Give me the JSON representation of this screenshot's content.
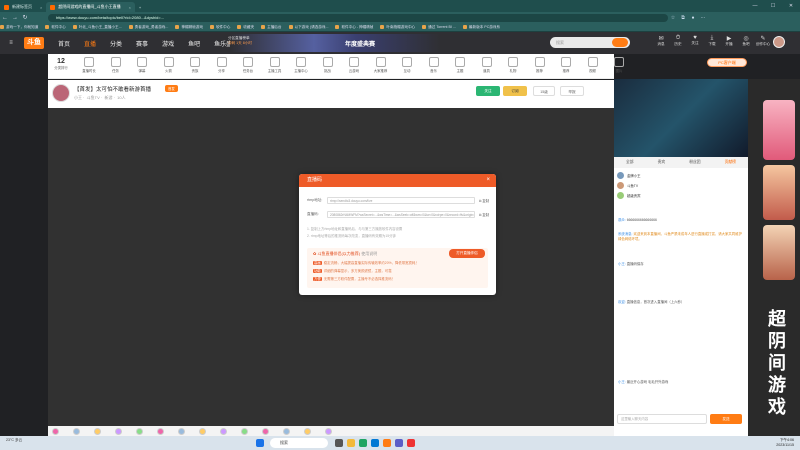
{
  "browser": {
    "tabs": [
      {
        "label": "新建标签页",
        "active": false
      },
      {
        "label": "超阴间游戏的直播间_斗鱼小王直播",
        "active": true
      }
    ],
    "new_tab": "+",
    "url": "https://www.douyu.com/beta/topic/bell?rid=2080...&dyshid=...",
    "bookmarks": [
      "游戏一下，你就知道",
      "软件中心",
      "叶北_斗鱼小王_直播小王...",
      "勇者游戏_勇者游戏...",
      "神帽精帧游戏",
      "软件中心",
      "收藏夹",
      "主播后台",
      "以下游戏 (请选游戏...",
      "软件中心 - 神帽精帧",
      "叶南拖帽游戏中心",
      "通过 Torrent BI ...",
      "最新版本 PC游戏系"
    ]
  },
  "douyu_header": {
    "logo": "斗鱼",
    "nav": [
      "首页",
      "直播",
      "分类",
      "赛事",
      "游戏",
      "鱼吧",
      "鱼乐盛典"
    ],
    "promo_lines": [
      "分区直播榜单",
      "冲刺 1天 8小时"
    ],
    "event": "年度盛典赛",
    "search_placeholder": "搜索",
    "header_icons": [
      "消息",
      "历史",
      "关注",
      "下载",
      "开播",
      "鱼吧",
      "创作中心"
    ]
  },
  "category_row": {
    "count": "12",
    "count_label": "分类排行",
    "items": [
      "直播时长",
      "任务",
      "弹幕",
      "火箭",
      "贵族",
      "分享",
      "任务台",
      "主播工具",
      "主播中心",
      "挑战",
      "云游戏",
      "大家推荐",
      "互动",
      "音乐",
      "主题",
      "道具",
      "礼物",
      "推荐",
      "推荐",
      "视频",
      "图片"
    ],
    "pc_client": "PC客户端"
  },
  "stream": {
    "title": "【首发】太可怕不敢看新游首播",
    "badge": "首发",
    "tags": [
      "小王",
      "斗鱼TV",
      "新游",
      "10人"
    ],
    "follow_btn": "关注",
    "sub_btn": "订阅",
    "level": "15级",
    "report": "举报"
  },
  "dialog": {
    "title": "直播码",
    "close": "×",
    "rtmp_label": "rtmp地址:",
    "rtmp_value": "rtmp://sendtc3.douyu.com/live",
    "code_label": "直播码:",
    "code_value": "2080862rN4MWFM?wsSecret=...&wsTime=...&wsSeek=off&wm=0&tw=0&roirpe=0&record=flv&origin=tct",
    "copy": "复制",
    "notes": [
      "1. 复制上方rtmp地址和直播码后，与与第三方播放软件内容设置",
      "2. rtmp地址等后的推流码每次改变，直播码有效期为15分钟"
    ],
    "promo_title": "斗鱼直播伴侣(以力推荐)",
    "promo_tag": "使用说明",
    "open_btn": "打开直播伴侣",
    "items": [
      {
        "tag": "高画",
        "text": "稳定流畅，大幅提高直播实际传输效率约20%，降低带宽损耗！"
      },
      {
        "tag": "功能",
        "text": "详细的弹幕显示，多方美颜滤镜，主题，可靠"
      },
      {
        "tag": "方便",
        "text": "无需第三方软件配置，主播专不必选择推流码！"
      }
    ]
  },
  "right_panel": {
    "tabs": [
      "全部",
      "贵宾",
      "粉丝团",
      "贡献榜"
    ],
    "rank": [
      "金牌小王",
      "斗鱼TV",
      "超级贵宾"
    ],
    "chat": [
      {
        "user": "观众:",
        "text": "6666666666666666"
      },
      {
        "user": "系统消息:",
        "text": "欢迎来到本直播间，斗鱼严禁未成年人进行直播或打赏，请大家共同维护绿色网络环境。"
      },
      {
        "user": "小王:",
        "text": "直播码保存"
      },
      {
        "user": "欢迎:",
        "text": "直播信息，首次进入直播间（上六秒）"
      },
      {
        "user": "小王:",
        "text": "最近开心游戏 毛毛开外游戏"
      }
    ],
    "input_placeholder": "这里输入聊天内容",
    "send": "发送"
  },
  "side_text": "超阴间游戏",
  "taskbar": {
    "weather": "23°C 多云",
    "search": "搜索",
    "time": "下午4:06",
    "date": "2023/11/15"
  },
  "colors": {
    "brand": "#ff7c14",
    "dialog_head": "#ee5b28",
    "browser": "#2b5f5e"
  }
}
